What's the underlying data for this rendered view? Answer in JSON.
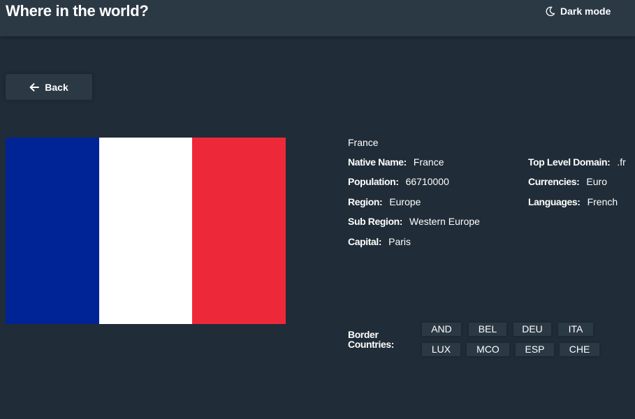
{
  "header": {
    "title": "Where in the world?",
    "mode_label": "Dark mode",
    "mode_icon": "moon-icon"
  },
  "back": {
    "label": "Back",
    "icon": "arrow-left-icon"
  },
  "flag": {
    "colors": [
      "#002395",
      "#ffffff",
      "#ed2939"
    ]
  },
  "country": {
    "name": "France",
    "native_name": {
      "label": "Native Name:",
      "value": "France"
    },
    "population": {
      "label": "Population:",
      "value": "66710000"
    },
    "region": {
      "label": "Region:",
      "value": "Europe"
    },
    "sub_region": {
      "label": "Sub Region:",
      "value": "Western Europe"
    },
    "capital": {
      "label": "Capital:",
      "value": "Paris"
    },
    "top_level_domain": {
      "label": "Top Level Domain:",
      "value": ".fr"
    },
    "currencies": {
      "label": "Currencies:",
      "value": "Euro"
    },
    "languages": {
      "label": "Languages:",
      "value": "French"
    }
  },
  "borders": {
    "label": "Border Countries:",
    "countries": [
      "AND",
      "BEL",
      "DEU",
      "ITA",
      "LUX",
      "MCO",
      "ESP",
      "CHE"
    ]
  },
  "colors": {
    "background": "#202c37",
    "element": "#2b3945",
    "text": "#ffffff"
  }
}
